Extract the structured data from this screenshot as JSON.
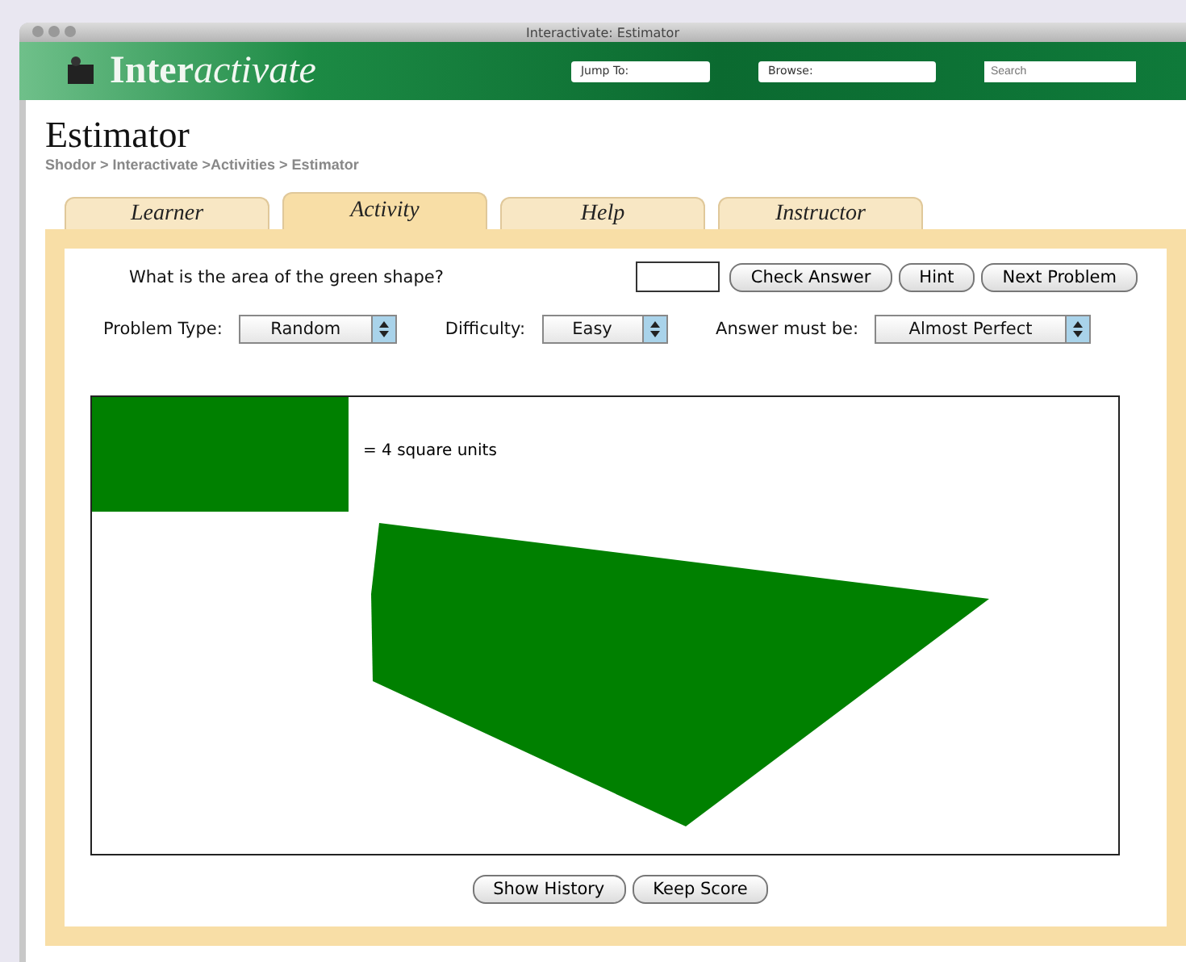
{
  "window": {
    "title": "Interactivate: Estimator"
  },
  "banner": {
    "logo_plain": "Inter",
    "logo_italic": "activate",
    "jump_to": "Jump To:",
    "browse": "Browse:",
    "search": {
      "placeholder": "Search"
    }
  },
  "page": {
    "title": "Estimator",
    "breadcrumb": "Shodor > Interactivate >Activities > Estimator"
  },
  "tabs": [
    {
      "label": "Learner",
      "selected": false
    },
    {
      "label": "Activity",
      "selected": true
    },
    {
      "label": "Help",
      "selected": false
    },
    {
      "label": "Instructor",
      "selected": false
    }
  ],
  "question": "What is the area of the green shape?",
  "buttons": [
    "Check Answer",
    "Hint",
    "Next Problem"
  ],
  "options": [
    {
      "label": "Problem Type:",
      "value": "Random"
    },
    {
      "label": "Difficulty:",
      "value": "Easy"
    },
    {
      "label": "Answer must be:",
      "value": "Almost Perfect"
    }
  ],
  "unit_label": "= 4 square units",
  "bottom_buttons": [
    "Show History",
    "Keep Score"
  ]
}
